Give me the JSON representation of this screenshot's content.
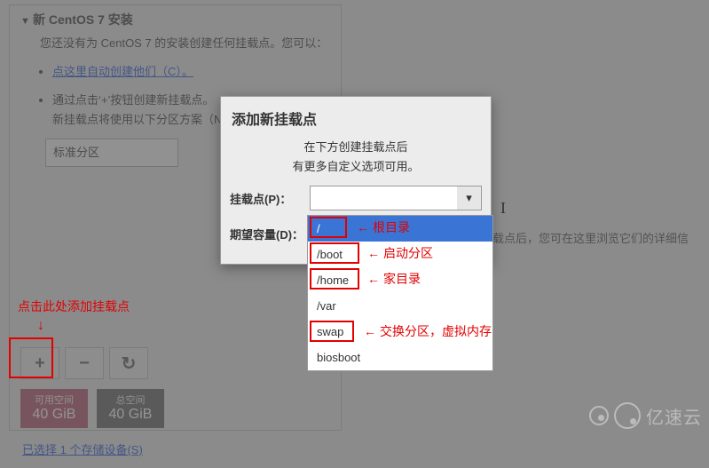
{
  "panel": {
    "title": "新 CentOS 7 安装",
    "desc": "您还没有为 CentOS 7 的安装创建任何挂载点。您可以：",
    "auto_link": "点这里自动创建他们（C）。",
    "bullet2": "通过点击‘+’按钮创建新挂载点。",
    "scheme_line": "新挂载点将使用以下分区方案（N）：",
    "scheme_value": "标准分区"
  },
  "toolbar": {
    "add": "+",
    "remove": "−",
    "reload": "↻"
  },
  "space": {
    "avail_lbl": "可用空间",
    "avail_val": "40 GiB",
    "total_lbl": "总空间",
    "total_val": "40 GiB"
  },
  "bottom_link": "已选择 1 个存储设备(S)",
  "dialog": {
    "title": "添加新挂载点",
    "sub1": "在下方创建挂载点后",
    "sub2": "有更多自定义选项可用。",
    "mount_lbl": "挂载点(P)：",
    "cap_lbl": "期望容量(D)：",
    "mount_val": "",
    "cap_val": ""
  },
  "options": {
    "root": "/",
    "boot": "/boot",
    "home": "/home",
    "var": "/var",
    "swap": "swap",
    "biosboot": "biosboot"
  },
  "anno": {
    "click_here": "点击此处添加挂载点",
    "root": "根目录",
    "boot": "启动分区",
    "home": "家目录",
    "swap": "交换分区，虚拟内存"
  },
  "right_note": "载点后，您可在这里浏览它们的详细信",
  "cursor": "I",
  "watermark": "亿速云"
}
